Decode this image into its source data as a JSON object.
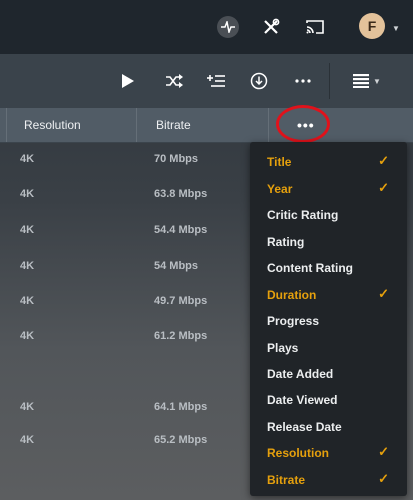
{
  "topbar": {
    "avatar_letter": "F",
    "icons": [
      "activity-icon",
      "settings-tools-icon",
      "cast-icon"
    ]
  },
  "toolbar": {
    "icons": [
      "play-icon",
      "shuffle-icon",
      "add-to-queue-icon",
      "download-icon",
      "more-icon",
      "view-list-icon"
    ]
  },
  "table": {
    "columns": [
      "Resolution",
      "Bitrate"
    ],
    "more_label": "•••",
    "rows": [
      {
        "resolution": "4K",
        "bitrate": "70 Mbps"
      },
      {
        "resolution": "4K",
        "bitrate": "63.8 Mbps"
      },
      {
        "resolution": "4K",
        "bitrate": "54.4 Mbps"
      },
      {
        "resolution": "4K",
        "bitrate": "54 Mbps"
      },
      {
        "resolution": "4K",
        "bitrate": "49.7 Mbps"
      },
      {
        "resolution": "4K",
        "bitrate": "61.2 Mbps"
      },
      {
        "resolution": "4K",
        "bitrate": "64.1 Mbps"
      },
      {
        "resolution": "4K",
        "bitrate": "65.2 Mbps"
      }
    ]
  },
  "menu": {
    "check_mark": "✓",
    "items": [
      {
        "label": "Title",
        "checked": true
      },
      {
        "label": "Year",
        "checked": true
      },
      {
        "label": "Critic Rating",
        "checked": false
      },
      {
        "label": "Rating",
        "checked": false
      },
      {
        "label": "Content Rating",
        "checked": false
      },
      {
        "label": "Duration",
        "checked": true
      },
      {
        "label": "Progress",
        "checked": false
      },
      {
        "label": "Plays",
        "checked": false
      },
      {
        "label": "Date Added",
        "checked": false
      },
      {
        "label": "Date Viewed",
        "checked": false
      },
      {
        "label": "Release Date",
        "checked": false
      },
      {
        "label": "Resolution",
        "checked": true
      },
      {
        "label": "Bitrate",
        "checked": true
      }
    ]
  },
  "colors": {
    "accent": "#e5a00d",
    "highlight_ring": "#e0121b"
  }
}
